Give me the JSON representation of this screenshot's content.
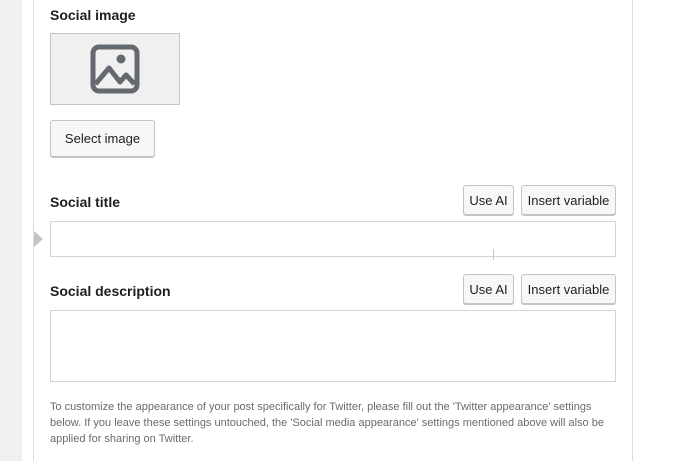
{
  "social_image": {
    "label": "Social image",
    "select_button": "Select image",
    "placeholder_icon": "image-icon"
  },
  "social_title": {
    "label": "Social title",
    "use_ai_button": "Use AI",
    "insert_variable_button": "Insert variable",
    "value": ""
  },
  "social_description": {
    "label": "Social description",
    "use_ai_button": "Use AI",
    "insert_variable_button": "Insert variable",
    "value": ""
  },
  "help_text": "To customize the appearance of your post specifically for Twitter, please fill out the 'Twitter appearance' settings below. If you leave these settings untouched, the 'Social media appearance' settings mentioned above will also be applied for sharing on Twitter.",
  "icons": {
    "collapse": "caret-right-icon"
  }
}
